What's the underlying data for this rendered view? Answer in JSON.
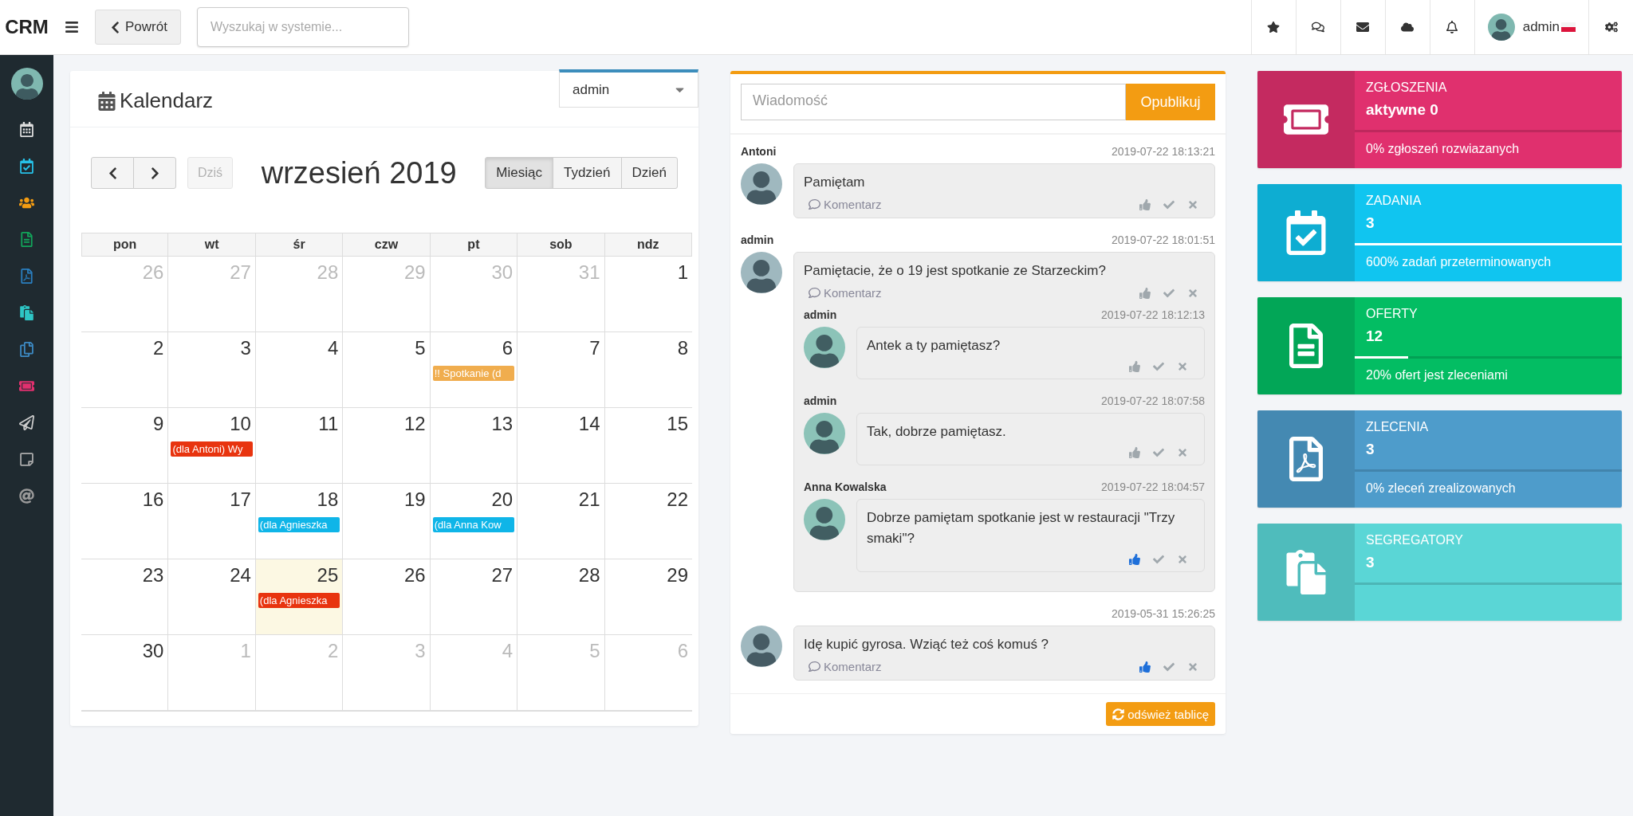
{
  "topbar": {
    "logo": "CRM",
    "back_button": "Powrót",
    "search": {
      "placeholder": "Wyszukaj w systemie..."
    },
    "user": "admin"
  },
  "sidebar": {
    "items": [
      {
        "color": "#dddddd"
      },
      {
        "color": "#26c1e8"
      },
      {
        "color": "#f39c12"
      },
      {
        "color": "#12a55a"
      },
      {
        "color": "#2a7fc0"
      },
      {
        "color": "#2ec6c6"
      },
      {
        "color": "#3d8ac4"
      },
      {
        "color": "#e0306e"
      },
      {
        "color": "#cccccc"
      },
      {
        "color": "#aaaaaa"
      },
      {
        "color": "#999999"
      }
    ]
  },
  "calendar": {
    "title": "Kalendarz",
    "user_select": "admin",
    "today_button": {
      "label": "Dziś",
      "disabled": true
    },
    "month_title": "wrzesień 2019",
    "views": [
      {
        "label": "Miesiąc",
        "selected": true
      },
      {
        "label": "Tydzień",
        "selected": false
      },
      {
        "label": "Dzień",
        "selected": false
      }
    ],
    "weekdays": [
      "pon",
      "wt",
      "śr",
      "czw",
      "pt",
      "sob",
      "ndz"
    ],
    "weeks": [
      [
        {
          "day": "26",
          "other_month": true,
          "today": false
        },
        {
          "day": "27",
          "other_month": true,
          "today": false
        },
        {
          "day": "28",
          "other_month": true,
          "today": false
        },
        {
          "day": "29",
          "other_month": true,
          "today": false
        },
        {
          "day": "30",
          "other_month": true,
          "today": false
        },
        {
          "day": "31",
          "other_month": true,
          "today": false
        },
        {
          "day": "1",
          "other_month": false,
          "today": false
        }
      ],
      [
        {
          "day": "2",
          "other_month": false,
          "today": false
        },
        {
          "day": "3",
          "other_month": false,
          "today": false
        },
        {
          "day": "4",
          "other_month": false,
          "today": false
        },
        {
          "day": "5",
          "other_month": false,
          "today": false
        },
        {
          "day": "6",
          "other_month": false,
          "today": false,
          "events": [
            {
              "label": "!! Spotkanie (d",
              "color": "#f0ad4e"
            }
          ]
        },
        {
          "day": "7",
          "other_month": false,
          "today": false
        },
        {
          "day": "8",
          "other_month": false,
          "today": false
        }
      ],
      [
        {
          "day": "9",
          "other_month": false,
          "today": false
        },
        {
          "day": "10",
          "other_month": false,
          "today": false,
          "events": [
            {
              "label": "(dla Antoni) Wy",
              "color": "#e8340f"
            }
          ]
        },
        {
          "day": "11",
          "other_month": false,
          "today": false
        },
        {
          "day": "12",
          "other_month": false,
          "today": false
        },
        {
          "day": "13",
          "other_month": false,
          "today": false
        },
        {
          "day": "14",
          "other_month": false,
          "today": false
        },
        {
          "day": "15",
          "other_month": false,
          "today": false
        }
      ],
      [
        {
          "day": "16",
          "other_month": false,
          "today": false
        },
        {
          "day": "17",
          "other_month": false,
          "today": false
        },
        {
          "day": "18",
          "other_month": false,
          "today": false,
          "events": [
            {
              "label": "(dla Agnieszka",
              "color": "#0fb5e8"
            }
          ]
        },
        {
          "day": "19",
          "other_month": false,
          "today": false
        },
        {
          "day": "20",
          "other_month": false,
          "today": false,
          "events": [
            {
              "label": "(dla Anna Kow",
              "color": "#0fb5e8"
            }
          ]
        },
        {
          "day": "21",
          "other_month": false,
          "today": false
        },
        {
          "day": "22",
          "other_month": false,
          "today": false
        }
      ],
      [
        {
          "day": "23",
          "other_month": false,
          "today": false
        },
        {
          "day": "24",
          "other_month": false,
          "today": false
        },
        {
          "day": "25",
          "other_month": false,
          "today": true,
          "events": [
            {
              "label": "(dla Agnieszka",
              "color": "#e8340f"
            }
          ]
        },
        {
          "day": "26",
          "other_month": false,
          "today": false
        },
        {
          "day": "27",
          "other_month": false,
          "today": false
        },
        {
          "day": "28",
          "other_month": false,
          "today": false
        },
        {
          "day": "29",
          "other_month": false,
          "today": false
        }
      ],
      [
        {
          "day": "30",
          "other_month": false,
          "today": false
        },
        {
          "day": "1",
          "other_month": true,
          "today": false
        },
        {
          "day": "2",
          "other_month": true,
          "today": false
        },
        {
          "day": "3",
          "other_month": true,
          "today": false
        },
        {
          "day": "4",
          "other_month": true,
          "today": false
        },
        {
          "day": "5",
          "other_month": true,
          "today": false
        },
        {
          "day": "6",
          "other_month": true,
          "today": false
        }
      ]
    ]
  },
  "wall": {
    "message_field": {
      "placeholder": "Wiadomość"
    },
    "publish_button": "Opublikuj",
    "refresh_button": "odśwież tablicę",
    "messages": [
      {
        "author": "Antoni",
        "time": "2019-07-22 18:13:21",
        "text": "Pamiętam",
        "comment_link": "Komentarz",
        "liked": false
      },
      {
        "author": "admin",
        "time": "2019-07-22 18:01:51",
        "text": "Pamiętacie, że o 19 jest spotkanie ze Starzeckim?",
        "comment_link": "Komentarz",
        "liked": false,
        "comments": [
          {
            "author": "admin",
            "time": "2019-07-22 18:12:13",
            "text": "Antek a ty pamiętasz?",
            "liked": false
          },
          {
            "author": "admin",
            "time": "2019-07-22 18:07:58",
            "text": "Tak, dobrze pamiętasz.",
            "liked": false
          },
          {
            "author": "Anna Kowalska",
            "time": "2019-07-22 18:04:57",
            "text": "Dobrze pamiętam spotkanie jest w restauracji \"Trzy smaki\"?",
            "liked": true
          }
        ]
      },
      {
        "time": "2019-05-31 15:26:25",
        "text": "Idę kupić gyrosa. Wziąć też coś komuś ?",
        "comment_link": "Komentarz",
        "liked": true
      }
    ]
  },
  "stats": [
    {
      "title": "ZGŁOSZENIA",
      "value": "aktywne 0",
      "footer": "0% zgłoszeń rozwiazanych",
      "level": 0,
      "color": "#e0306e"
    },
    {
      "title": "ZADANIA",
      "value": "3",
      "footer": "600% zadań przeterminowanych",
      "level": 1,
      "color": "#10c5f0"
    },
    {
      "title": "OFERTY",
      "value": "12",
      "footer": "20% ofert jest zleceniami",
      "level": 0.2,
      "color": "#03bd63"
    },
    {
      "title": "ZLECENIA",
      "value": "3",
      "footer": "0% zleceń zrealizowanych",
      "level": 0,
      "color": "#4e9ccb"
    },
    {
      "title": "SEGREGATORY",
      "value": "3",
      "level": 0,
      "color": "#5ad6d6"
    }
  ]
}
